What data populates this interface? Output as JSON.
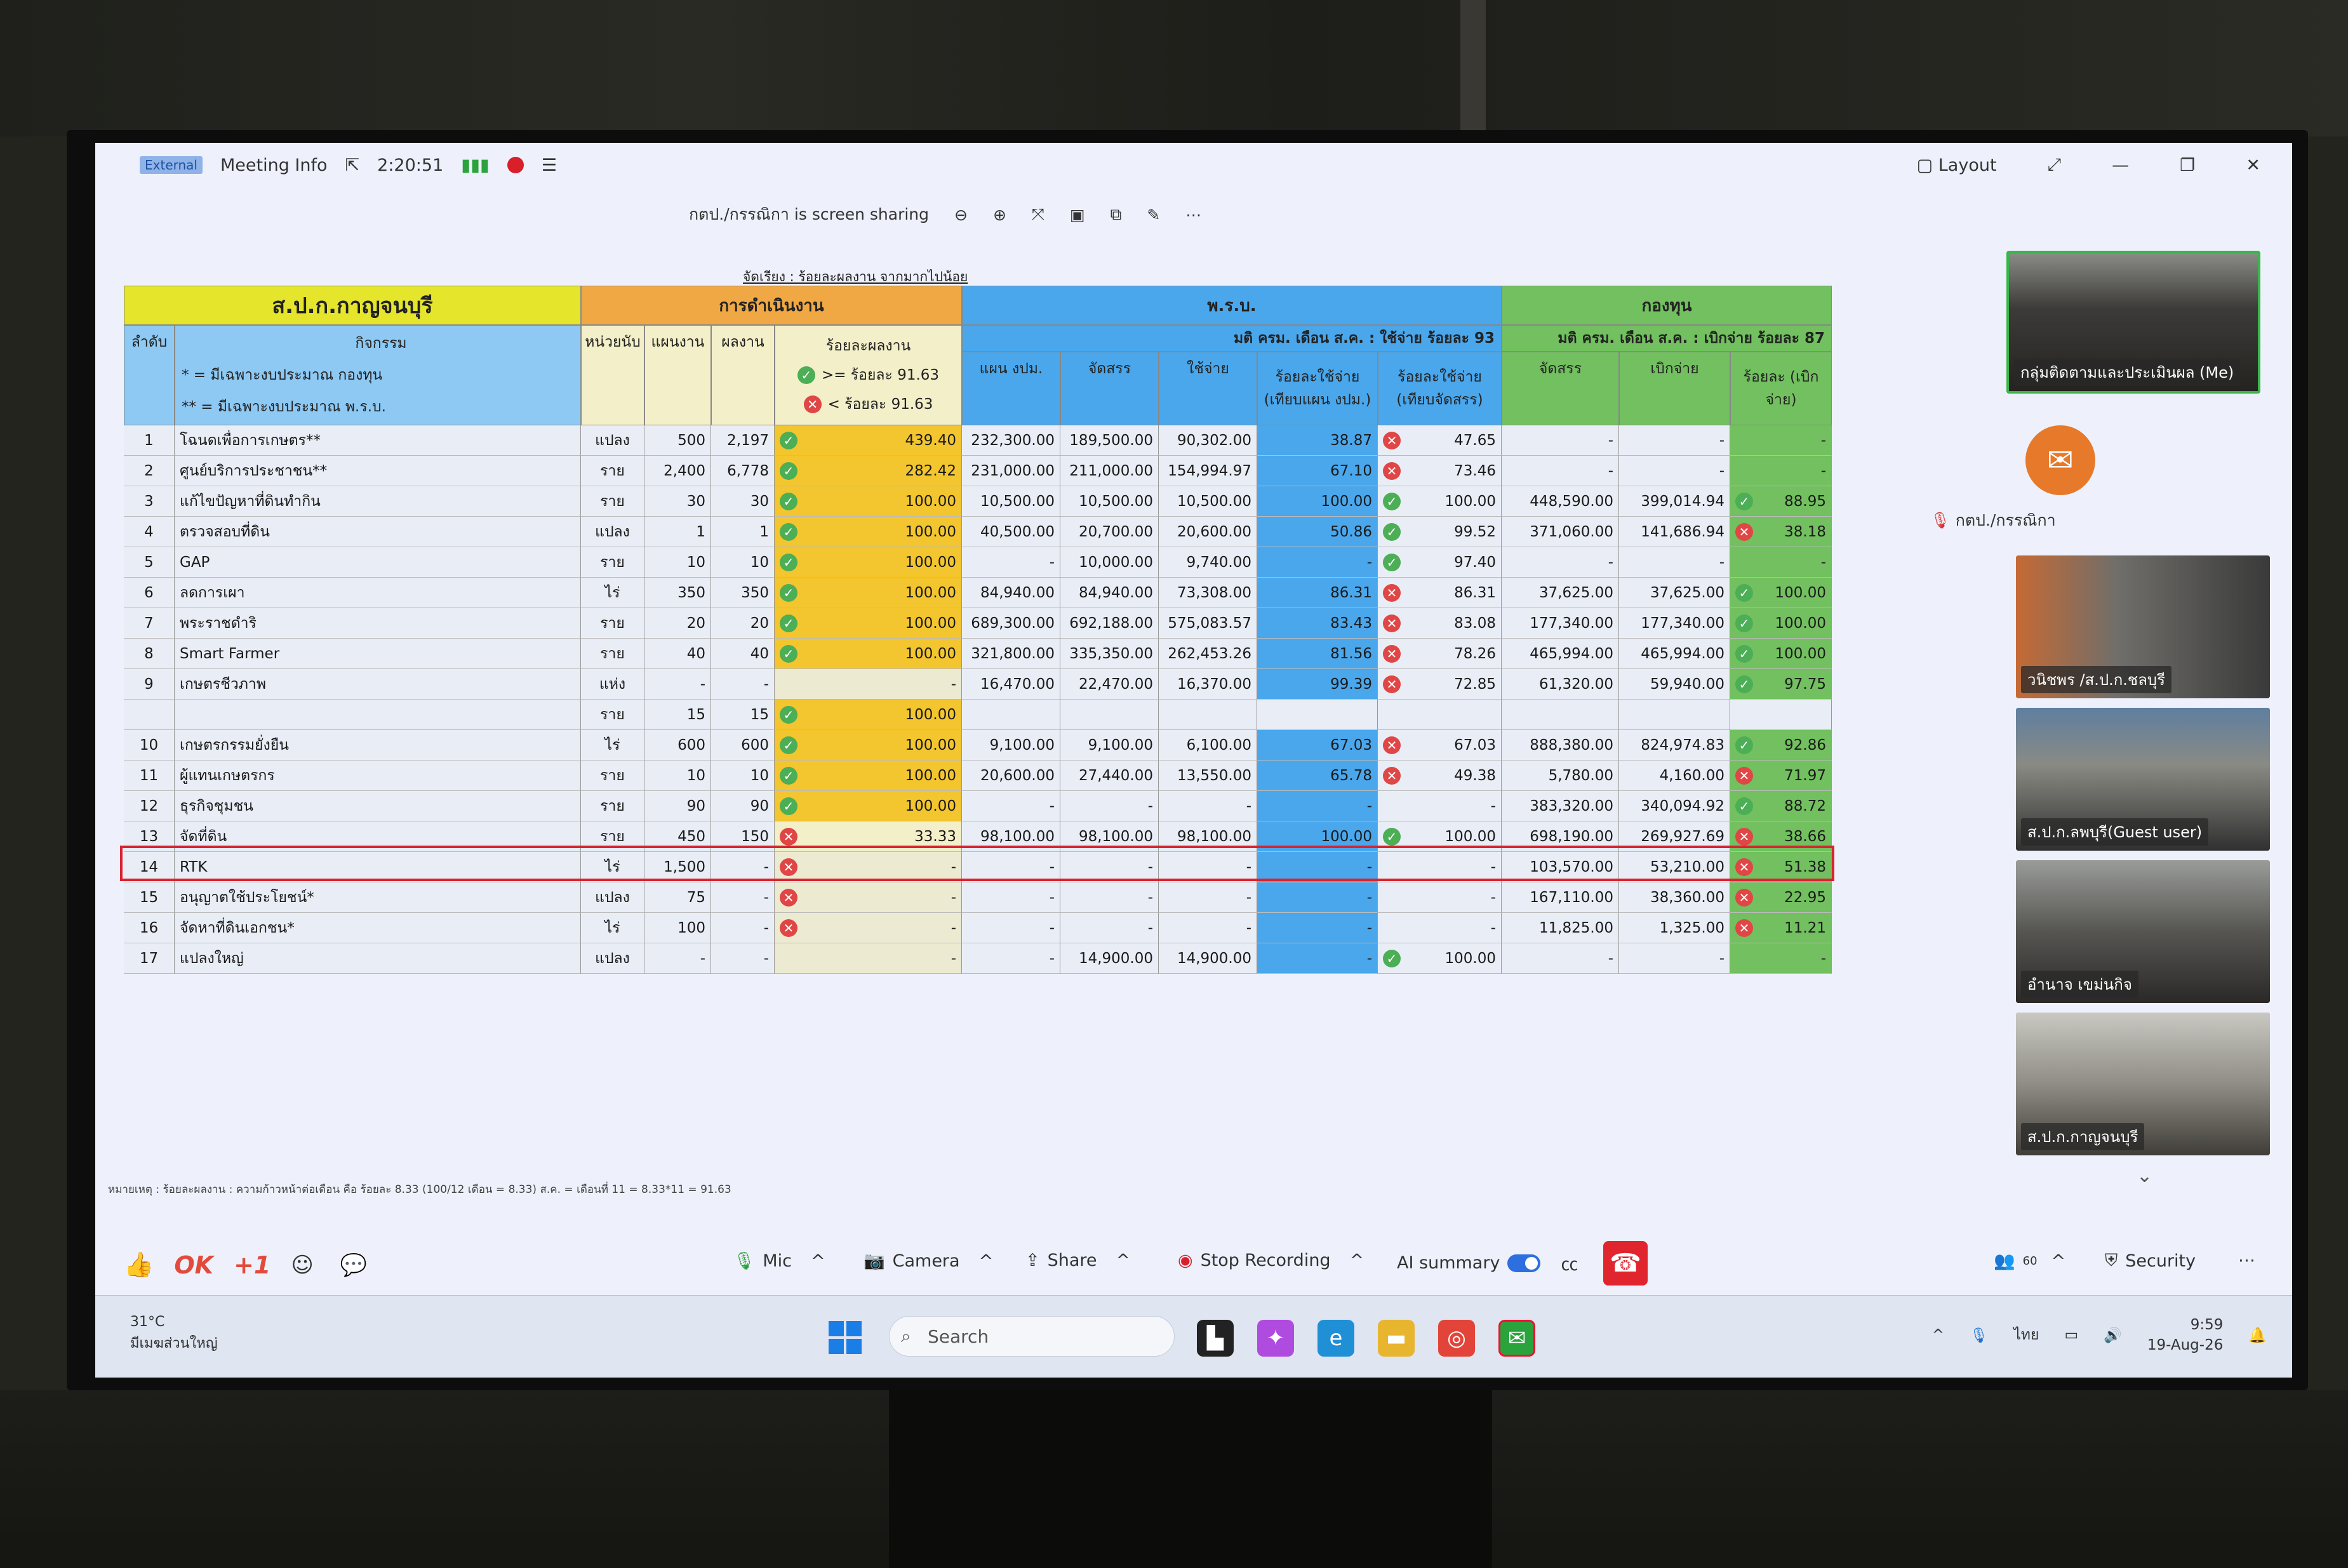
{
  "meeting": {
    "badge": "External",
    "info_label": "Meeting Info",
    "timer": "2:20:51",
    "layout_label": "Layout",
    "sharing_text": "กตป./กรรณิกา is screen sharing"
  },
  "sheet": {
    "caption": "จัดเรียง : ร้อยละผลงาน จากมากไปน้อย",
    "org": "ส.ป.ก.กาญจนบุรี",
    "grp_ops": "การดำเนินงาน",
    "grp_prb": "พ.ร.บ.",
    "grp_fund": "กองทุน",
    "prb_note": "มติ ครม. เดือน ส.ค. : ใช้จ่าย ร้อยละ 93",
    "fund_note": "มติ ครม. เดือน ส.ค. : เบิกจ่าย ร้อยละ 87",
    "h_no": "ลำดับ",
    "h_activity": "กิจกรรม",
    "note1": "* = มีเฉพาะงบประมาณ กองทุน",
    "note2": "** = มีเฉพาะงบประมาณ พ.ร.บ.",
    "h_unit": "หน่วยนับ",
    "h_plan": "แผนงาน",
    "h_result": "ผลงาน",
    "h_pct": "ร้อยละผลงาน",
    "legend_ok": ">= ร้อยละ 91.63",
    "legend_no": "< ร้อยละ 91.63",
    "h_plan_budget": "แผน งปม.",
    "h_alloc": "จัดสรร",
    "h_spend": "ใช้จ่าย",
    "h_pct_plan": "ร้อยละใช้จ่าย (เทียบแผน งปม.)",
    "h_pct_alloc": "ร้อยละใช้จ่าย (เทียบจัดสรร)",
    "h_f_alloc": "จัดสรร",
    "h_f_disb": "เบิกจ่าย",
    "h_f_pct": "ร้อยละ (เบิกจ่าย)",
    "footnote": "หมายเหตุ : ร้อยละผลงาน : ความก้าวหน้าต่อเดือน คือ ร้อยละ 8.33 (100/12 เดือน = 8.33) ส.ค. = เดือนที่ 11 = 8.33*11 = 91.63"
  },
  "rows": [
    {
      "no": "1",
      "act": "โฉนดเพื่อการเกษตร**",
      "unit": "แปลง",
      "plan": "500",
      "res": "2,197",
      "s": "ok",
      "pct": "439.40",
      "pb": "232,300.00",
      "al": "189,500.00",
      "sp": "90,302.00",
      "pp": "38.87",
      "ps": "no",
      "pa": "47.65",
      "fa": "-",
      "fd": "-",
      "fs": "",
      "fp": "-"
    },
    {
      "no": "2",
      "act": "ศูนย์บริการประชาชน**",
      "unit": "ราย",
      "plan": "2,400",
      "res": "6,778",
      "s": "ok",
      "pct": "282.42",
      "pb": "231,000.00",
      "al": "211,000.00",
      "sp": "154,994.97",
      "pp": "67.10",
      "ps": "no",
      "pa": "73.46",
      "fa": "-",
      "fd": "-",
      "fs": "",
      "fp": "-"
    },
    {
      "no": "3",
      "act": "แก้ไขปัญหาที่ดินทำกิน",
      "unit": "ราย",
      "plan": "30",
      "res": "30",
      "s": "ok",
      "pct": "100.00",
      "pb": "10,500.00",
      "al": "10,500.00",
      "sp": "10,500.00",
      "pp": "100.00",
      "ps": "ok",
      "pa": "100.00",
      "fa": "448,590.00",
      "fd": "399,014.94",
      "fs": "ok",
      "fp": "88.95"
    },
    {
      "no": "4",
      "act": "ตรวจสอบที่ดิน",
      "unit": "แปลง",
      "plan": "1",
      "res": "1",
      "s": "ok",
      "pct": "100.00",
      "pb": "40,500.00",
      "al": "20,700.00",
      "sp": "20,600.00",
      "pp": "50.86",
      "ps": "ok",
      "pa": "99.52",
      "fa": "371,060.00",
      "fd": "141,686.94",
      "fs": "no",
      "fp": "38.18"
    },
    {
      "no": "5",
      "act": "GAP",
      "unit": "ราย",
      "plan": "10",
      "res": "10",
      "s": "ok",
      "pct": "100.00",
      "pb": "-",
      "al": "10,000.00",
      "sp": "9,740.00",
      "pp": "-",
      "ps": "ok",
      "pa": "97.40",
      "fa": "-",
      "fd": "-",
      "fs": "",
      "fp": "-"
    },
    {
      "no": "6",
      "act": "ลดการเผา",
      "unit": "ไร่",
      "plan": "350",
      "res": "350",
      "s": "ok",
      "pct": "100.00",
      "pb": "84,940.00",
      "al": "84,940.00",
      "sp": "73,308.00",
      "pp": "86.31",
      "ps": "no",
      "pa": "86.31",
      "fa": "37,625.00",
      "fd": "37,625.00",
      "fs": "ok",
      "fp": "100.00"
    },
    {
      "no": "7",
      "act": "พระราชดำริ",
      "unit": "ราย",
      "plan": "20",
      "res": "20",
      "s": "ok",
      "pct": "100.00",
      "pb": "689,300.00",
      "al": "692,188.00",
      "sp": "575,083.57",
      "pp": "83.43",
      "ps": "no",
      "pa": "83.08",
      "fa": "177,340.00",
      "fd": "177,340.00",
      "fs": "ok",
      "fp": "100.00"
    },
    {
      "no": "8",
      "act": "Smart Farmer",
      "unit": "ราย",
      "plan": "40",
      "res": "40",
      "s": "ok",
      "pct": "100.00",
      "pb": "321,800.00",
      "al": "335,350.00",
      "sp": "262,453.26",
      "pp": "81.56",
      "ps": "no",
      "pa": "78.26",
      "fa": "465,994.00",
      "fd": "465,994.00",
      "fs": "ok",
      "fp": "100.00"
    },
    {
      "no": "9",
      "act": "เกษตรชีวภาพ",
      "unit": "แห่ง",
      "plan": "-",
      "res": "-",
      "s": "",
      "pct": "-",
      "pb": "16,470.00",
      "al": "22,470.00",
      "sp": "16,370.00",
      "pp": "99.39",
      "ps": "no",
      "pa": "72.85",
      "fa": "61,320.00",
      "fd": "59,940.00",
      "fs": "ok",
      "fp": "97.75"
    },
    {
      "no": "",
      "act": "",
      "unit": "ราย",
      "plan": "15",
      "res": "15",
      "s": "ok",
      "pct": "100.00",
      "pb": "",
      "al": "",
      "sp": "",
      "pp": "",
      "ps": "",
      "pa": "",
      "fa": "",
      "fd": "",
      "fs": "",
      "fp": ""
    },
    {
      "no": "10",
      "act": "เกษตรกรรมยั่งยืน",
      "unit": "ไร่",
      "plan": "600",
      "res": "600",
      "s": "ok",
      "pct": "100.00",
      "pb": "9,100.00",
      "al": "9,100.00",
      "sp": "6,100.00",
      "pp": "67.03",
      "ps": "no",
      "pa": "67.03",
      "fa": "888,380.00",
      "fd": "824,974.83",
      "fs": "ok",
      "fp": "92.86"
    },
    {
      "no": "11",
      "act": "ผู้แทนเกษตรกร",
      "unit": "ราย",
      "plan": "10",
      "res": "10",
      "s": "ok",
      "pct": "100.00",
      "pb": "20,600.00",
      "al": "27,440.00",
      "sp": "13,550.00",
      "pp": "65.78",
      "ps": "no",
      "pa": "49.38",
      "fa": "5,780.00",
      "fd": "4,160.00",
      "fs": "no",
      "fp": "71.97"
    },
    {
      "no": "12",
      "act": "ธุรกิจชุมชน",
      "unit": "ราย",
      "plan": "90",
      "res": "90",
      "s": "ok",
      "pct": "100.00",
      "pb": "-",
      "al": "-",
      "sp": "-",
      "pp": "-",
      "ps": "",
      "pa": "-",
      "fa": "383,320.00",
      "fd": "340,094.92",
      "fs": "ok",
      "fp": "88.72"
    },
    {
      "no": "13",
      "act": "จัดที่ดิน",
      "unit": "ราย",
      "plan": "450",
      "res": "150",
      "s": "no",
      "pct": "33.33",
      "pb": "98,100.00",
      "al": "98,100.00",
      "sp": "98,100.00",
      "pp": "100.00",
      "ps": "ok",
      "pa": "100.00",
      "fa": "698,190.00",
      "fd": "269,927.69",
      "fs": "no",
      "fp": "38.66"
    },
    {
      "no": "14",
      "act": "RTK",
      "unit": "ไร่",
      "plan": "1,500",
      "res": "-",
      "s": "no",
      "pct": "-",
      "pb": "-",
      "al": "-",
      "sp": "-",
      "pp": "-",
      "ps": "",
      "pa": "-",
      "fa": "103,570.00",
      "fd": "53,210.00",
      "fs": "no",
      "fp": "51.38"
    },
    {
      "no": "15",
      "act": "อนุญาตใช้ประโยชน์*",
      "unit": "แปลง",
      "plan": "75",
      "res": "-",
      "s": "no",
      "pct": "-",
      "pb": "-",
      "al": "-",
      "sp": "-",
      "pp": "-",
      "ps": "",
      "pa": "-",
      "fa": "167,110.00",
      "fd": "38,360.00",
      "fs": "no",
      "fp": "22.95"
    },
    {
      "no": "16",
      "act": "จัดหาที่ดินเอกชน*",
      "unit": "ไร่",
      "plan": "100",
      "res": "-",
      "s": "no",
      "pct": "-",
      "pb": "-",
      "al": "-",
      "sp": "-",
      "pp": "-",
      "ps": "",
      "pa": "-",
      "fa": "11,825.00",
      "fd": "1,325.00",
      "fs": "no",
      "fp": "11.21"
    },
    {
      "no": "17",
      "act": "แปลงใหญ่",
      "unit": "แปลง",
      "plan": "-",
      "res": "-",
      "s": "",
      "pct": "-",
      "pb": "-",
      "al": "14,900.00",
      "sp": "14,900.00",
      "pp": "-",
      "ps": "ok",
      "pa": "100.00",
      "fa": "-",
      "fd": "-",
      "fs": "",
      "fp": "-"
    }
  ],
  "participants": [
    {
      "name": "กลุ่มติดตามและประเมินผล (Me)"
    },
    {
      "name": "กตป./กรรณิกา"
    },
    {
      "name": "วนิชพร /ส.ป.ก.ชลบุรี"
    },
    {
      "name": "ส.ป.ก.ลพบุรี(Guest user)"
    },
    {
      "name": "อำนาจ เขม่นกิจ"
    },
    {
      "name": "ส.ป.ก.กาญจนบุรี"
    }
  ],
  "toolbar": {
    "react_ok": "OK",
    "react_plus": "+1",
    "mic": "Mic",
    "camera": "Camera",
    "share": "Share",
    "stop_rec": "Stop Recording",
    "ai": "AI summary",
    "security": "Security",
    "count": "60"
  },
  "taskbar": {
    "temp": "31°C",
    "weather": "มีเมฆส่วนใหญ่",
    "search": "Search",
    "lang": "ไทย",
    "time": "9:59",
    "date": "19-Aug-26"
  }
}
